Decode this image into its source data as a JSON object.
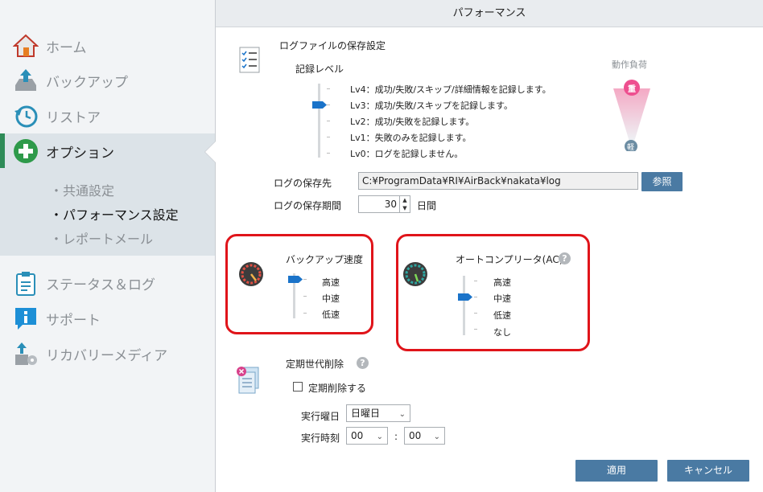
{
  "window": {
    "title": "パフォーマンス"
  },
  "sidebar": {
    "items": [
      {
        "label": "ホーム",
        "icon": "home-icon"
      },
      {
        "label": "バックアップ",
        "icon": "backup-icon"
      },
      {
        "label": "リストア",
        "icon": "restore-icon"
      },
      {
        "label": "オプション",
        "icon": "option-plus-icon"
      },
      {
        "label": "ステータス＆ログ",
        "icon": "clipboard-icon"
      },
      {
        "label": "サポート",
        "icon": "info-icon"
      },
      {
        "label": "リカバリーメディア",
        "icon": "recovery-media-icon"
      }
    ],
    "submenu": [
      {
        "label": "・共通設定"
      },
      {
        "label": "・パフォーマンス設定"
      },
      {
        "label": "・レポートメール"
      }
    ]
  },
  "log_settings": {
    "section_title": "ログファイルの保存設定",
    "level_label": "記録レベル",
    "levels": [
      "Lv4：成功/失敗/スキップ/詳細情報を記録します。",
      "Lv3：成功/失敗/スキップを記録します。",
      "Lv2：成功/失敗を記録します。",
      "Lv1：失敗のみを記録します。",
      "Lv0：ログを記録しません。"
    ],
    "selected_level": "Lv3",
    "load_label": "動作負荷",
    "load_heavy": "重",
    "load_light": "軽",
    "path_label": "ログの保存先",
    "path_value": "C:¥ProgramData¥RI¥AirBack¥nakata¥log",
    "browse_button": "参照",
    "period_label": "ログの保存期間",
    "period_value": "30",
    "period_unit": "日間"
  },
  "backup_speed": {
    "title": "バックアップ速度",
    "options": [
      "高速",
      "中速",
      "低速"
    ],
    "selected": "高速"
  },
  "auto_complete": {
    "title": "オートコンプリータ(AC)",
    "help": "?",
    "options": [
      "高速",
      "中速",
      "低速",
      "なし"
    ],
    "selected": "中速"
  },
  "periodic_delete": {
    "title": "定期世代削除",
    "help": "?",
    "checkbox_label": "定期削除する",
    "checked": false,
    "day_label": "実行曜日",
    "day_value": "日曜日",
    "time_label": "実行時刻",
    "hour_value": "00",
    "colon": ":",
    "minute_value": "00"
  },
  "footer": {
    "apply": "適用",
    "cancel": "キャンセル"
  },
  "colors": {
    "accent": "#4a7aa3",
    "highlight": "#e0141a",
    "slider_thumb": "#1a73c9",
    "selected_nav_bar": "#2e8b57"
  }
}
